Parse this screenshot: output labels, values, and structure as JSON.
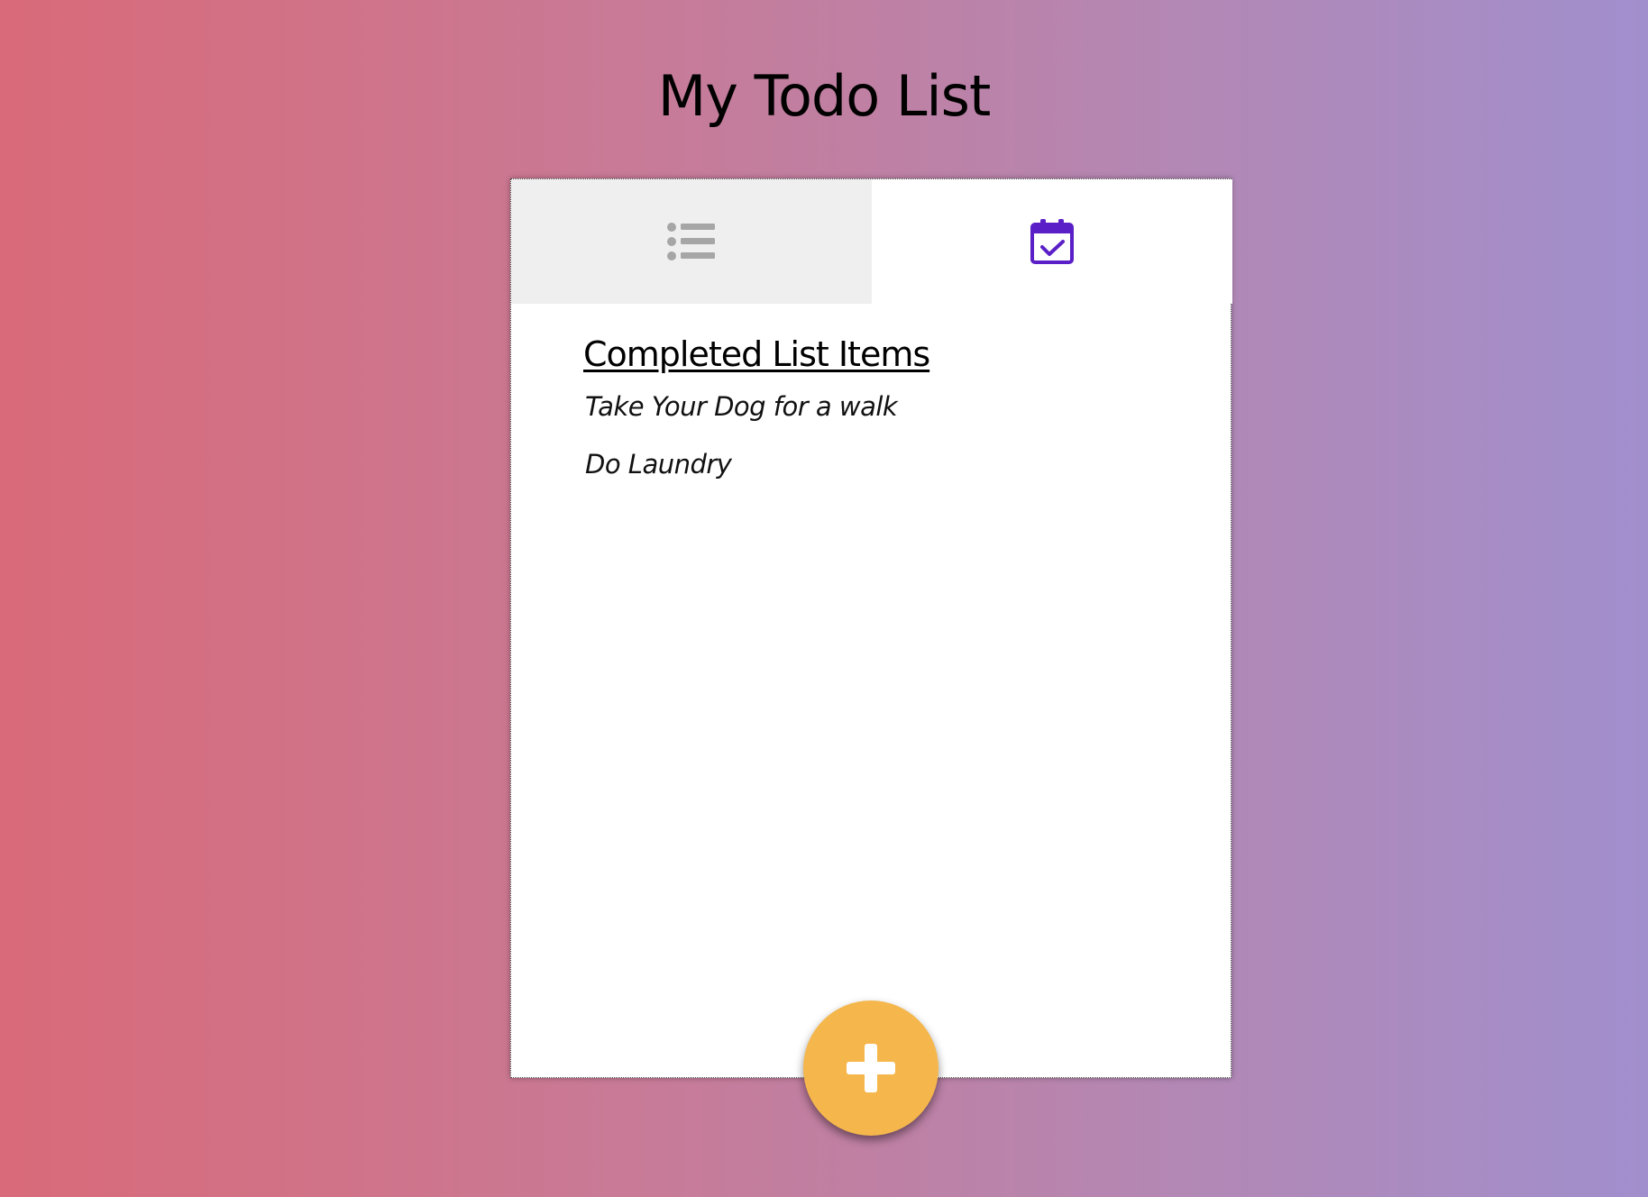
{
  "header": {
    "title": "My Todo List"
  },
  "tabs": [
    {
      "name": "todo-list",
      "icon": "list-icon",
      "active": false,
      "icon_color": "#a6a6a6"
    },
    {
      "name": "completed",
      "icon": "calendar-check-icon",
      "active": true,
      "icon_color": "#5a1fc7"
    }
  ],
  "completed_section": {
    "heading": "Completed List Items",
    "items": [
      "Take Your Dog for a walk",
      "Do Laundry"
    ]
  },
  "fab": {
    "icon": "plus-icon",
    "color": "#f5b74c"
  },
  "colors": {
    "gradient_start": "#d96a79",
    "gradient_end": "#a18fcd",
    "accent": "#5a1fc7"
  }
}
